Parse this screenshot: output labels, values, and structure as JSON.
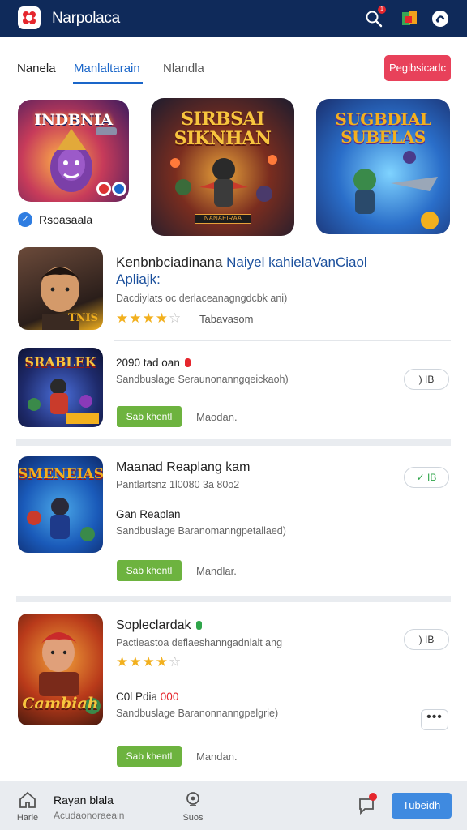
{
  "header": {
    "app_title": "Narpolaca",
    "icons": [
      "logo-icon",
      "search-icon",
      "gallery-icon",
      "chat-icon"
    ],
    "search_badge": "1"
  },
  "tabs": [
    {
      "label": "Nanela"
    },
    {
      "label": "Manlaltarain"
    },
    {
      "label": "Nlandla"
    }
  ],
  "signin_label": "Pegibsicadc",
  "featured": [
    {
      "art_text": "INDBNIA",
      "label": "Rsoasaala"
    },
    {
      "art_text": "SIRBSAI SIKNHAN",
      "caption": "NANAEIRAA"
    },
    {
      "art_text": "SUGBDIAL SUBELAS"
    }
  ],
  "list": [
    {
      "thumb_text": "TNIS",
      "title_main": "Kenbnbciadinana",
      "title_blue": "Naiyel kahielaVanCiaol",
      "title_line2": "Apliajk:",
      "subtitle": "Dacdiylats oc derlaceanagngdcbk ani)",
      "rating": 4,
      "rating_label": "Tabavasom"
    },
    {
      "thumb_text": "SRABLEK",
      "meta": "2090 tad oan",
      "subtitle": "Sandbuslage Seraunonanngqeickaoh)",
      "get_label": "Sab khentl",
      "more_label": "Maodan.",
      "pill": ") IB"
    },
    {
      "thumb_text": "SMENEIAS",
      "title": "Maanad Reaplang kam",
      "subtitle": "Pantlartsnz 1l0080 3a 80o2",
      "meta": "Gan Reaplan",
      "subtitle2": "Sandbuslage Baranomanngpetallaed)",
      "get_label": "Sab khentl",
      "more_label": "Mandlar.",
      "pill": "✓ IB"
    },
    {
      "thumb_text": "Cambiah",
      "title": "Sopleclardak",
      "subtitle": "Pactieastoa deflaeshanngadnlalt ang",
      "rating": 4,
      "meta": "C0l Pdia",
      "meta_red": "000",
      "subtitle2": "Sandbuslage Baranonnanngpelgrie)",
      "get_label": "Sab khentl",
      "more_label": "Mandan.",
      "pill": ") IB",
      "dots": "•••"
    }
  ],
  "bottom_nav": {
    "home_label": "Harie",
    "title": "Rayan blala",
    "subtitle": "Acudaonoraeain",
    "mid_label": "Suos",
    "submit_label": "Tubeidh"
  }
}
